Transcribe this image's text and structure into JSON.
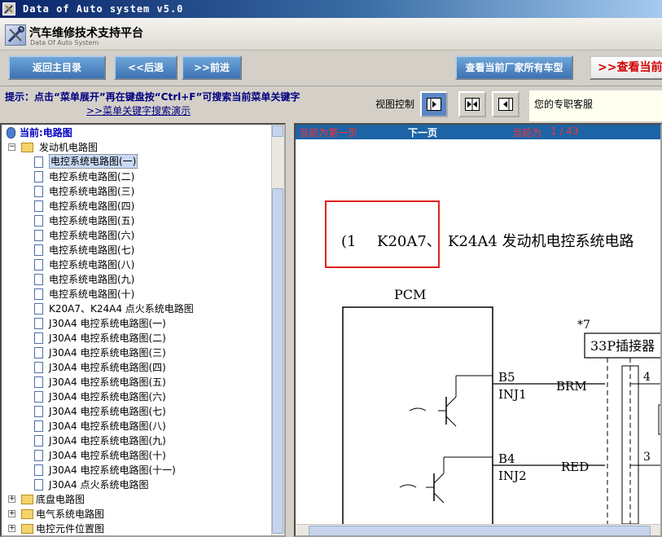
{
  "window": {
    "title": "Data of Auto system v5.0",
    "app_icon": "wrench-tools-icon"
  },
  "brand": {
    "title": "汽车维修技术支持平台",
    "subtitle": "Data Of Auto System"
  },
  "toolbar": {
    "home_label": "返回主目录",
    "back_label": "<<后退",
    "forward_label": ">>前进",
    "all_models_label": "查看当前厂家所有车型",
    "view_current_label": "查看当前"
  },
  "hint": {
    "text": "提示：点击“菜单展开”再在键盘按“Ctrl+F”可搜索当前菜单关键字",
    "demo_link": ">>菜单关键字搜索演示"
  },
  "view_control": {
    "label": "视图控制"
  },
  "support": {
    "text": "您的专职客服"
  },
  "tree": {
    "current_label": "当前:电路图",
    "engine_folder": "发动机电路图",
    "engine_items": [
      "电控系统电路图(一)",
      "电控系统电路图(二)",
      "电控系统电路图(三)",
      "电控系统电路图(四)",
      "电控系统电路图(五)",
      "电控系统电路图(六)",
      "电控系统电路图(七)",
      "电控系统电路图(八)",
      "电控系统电路图(九)",
      "电控系统电路图(十)",
      "K20A7、K24A4 点火系统电路图",
      "J30A4 电控系统电路图(一)",
      "J30A4 电控系统电路图(二)",
      "J30A4 电控系统电路图(三)",
      "J30A4 电控系统电路图(四)",
      "J30A4 电控系统电路图(五)",
      "J30A4 电控系统电路图(六)",
      "J30A4 电控系统电路图(七)",
      "J30A4 电控系统电路图(八)",
      "J30A4 电控系统电路图(九)",
      "J30A4 电控系统电路图(十)",
      "J30A4 电控系统电路图(十一)",
      "J30A4 点火系统电路图"
    ],
    "other_folders": [
      "底盘电路图",
      "电气系统电路图",
      "电控元件位置图"
    ]
  },
  "pager": {
    "first_page": "当前为第一页",
    "next_page": "下一页",
    "current_prefix": "当前为",
    "current_page": "1 / 43"
  },
  "diagram": {
    "heading_num": "1",
    "heading_models": "K20A7、",
    "heading_rest": "K24A4 发动机电控系统电路",
    "pcm_label": "PCM",
    "note_marker": "*7",
    "connector_label": "33P插接器",
    "pin_b5": "B5",
    "inj1": "INJ1",
    "wire_brm": "BRM",
    "pin_b4": "B4",
    "inj2": "INJ2",
    "wire_red": "RED",
    "conn_pin_4": "4",
    "conn_pin_3": "3",
    "highlight_color": "#e02020"
  }
}
